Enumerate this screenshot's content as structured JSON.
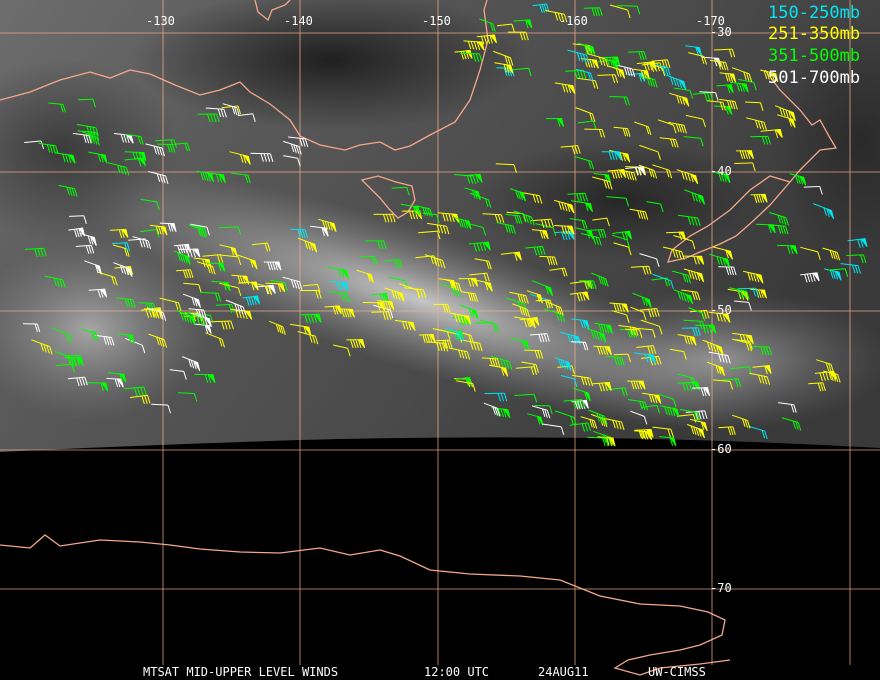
{
  "map": {
    "longitude_labels": [
      "-130",
      "-140",
      "-150",
      "-160",
      "-170"
    ],
    "latitude_labels": [
      "-30",
      "-40",
      "-50",
      "-60",
      "-70"
    ],
    "grid_color": "#f4b08c",
    "coast_color": "#f4a88a"
  },
  "legend": [
    {
      "label": "150-250mb",
      "color": "#00e5f0"
    },
    {
      "label": "251-350mb",
      "color": "#ffff00"
    },
    {
      "label": "351-500mb",
      "color": "#00ff00"
    },
    {
      "label": "501-700mb",
      "color": "#ffffff"
    }
  ],
  "footer": {
    "product": "MTSAT MID-UPPER LEVEL WINDS",
    "time": "12:00 UTC",
    "date": "24AUG11",
    "source": "UW-CIMSS"
  }
}
